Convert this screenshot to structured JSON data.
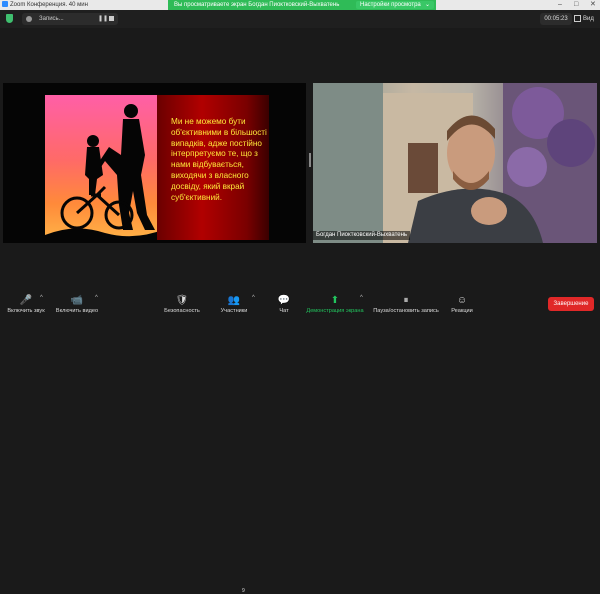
{
  "titlebar": {
    "app_title": "Zoom Конференция. 40 мин",
    "banner_text": "Вы просматриваете экран Богдан Пиоктковский-Выхватень",
    "view_options_label": "Настройки просмотра",
    "caret": "⌄",
    "window_controls": [
      "–",
      "□",
      "✕"
    ]
  },
  "topbar": {
    "recording_label": "Запись...",
    "pause_glyph": "❚❚",
    "timer": "00:05:23",
    "view_label": "Вид"
  },
  "slide": {
    "text": "Ми не можемо бути об'єктивними в більшості випадків, адже постійно інтерпретуємо те, що з нами відбувається, виходячи з власного досвіду, який вкрай суб'єктивний."
  },
  "participant": {
    "name": "Богдан Пиоктковский-Выхватень"
  },
  "toolbar": {
    "items": [
      {
        "label": "Включить звук",
        "icon": "mic-muted-icon",
        "glyph": "🎤"
      },
      {
        "label": "Включить видео",
        "icon": "video-off-icon",
        "glyph": "📹"
      },
      {
        "label": "Безопасность",
        "icon": "shield-icon",
        "glyph": "🛡"
      },
      {
        "label": "Участники",
        "icon": "participants-icon",
        "glyph": "👥",
        "count": "9"
      },
      {
        "label": "Чат",
        "icon": "chat-icon",
        "glyph": "💬"
      },
      {
        "label": "Демонстрация экрана",
        "icon": "share-screen-icon",
        "glyph": "⬆"
      },
      {
        "label": "Пауза/остановить запись",
        "icon": "pause-record-icon",
        "glyph": "⏸"
      },
      {
        "label": "Реакции",
        "icon": "reactions-icon",
        "glyph": "☺"
      }
    ],
    "end_label": "Завершение",
    "caret": "^"
  },
  "colors": {
    "banner_green": "#2fbb57",
    "end_red": "#e02828",
    "share_green": "#22c55e",
    "slide_text": "#ffe93a"
  }
}
